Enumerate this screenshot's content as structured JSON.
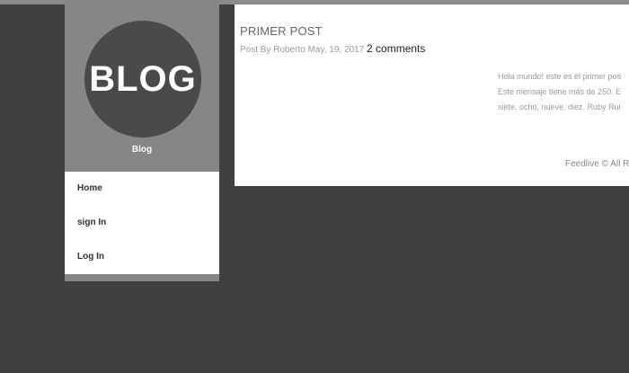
{
  "sidebar": {
    "logo_text": "BLOG",
    "blog_name": "Blog",
    "nav": [
      {
        "label": "Home"
      },
      {
        "label": "sign In"
      },
      {
        "label": "Log In"
      }
    ]
  },
  "post": {
    "title": "PRIMER POST",
    "meta": "Post By Roberto May, 19, 2017",
    "comments_label": "2 comments",
    "body_lines": [
      "Hola mundo! este es el primer pos",
      "Este mensaje tiene más de 250. E",
      "siete, ocho, nueve, diez. Ruby Rul"
    ]
  },
  "footer": {
    "text": "Feedlive © All Ri"
  },
  "colors": {
    "page_background": "#404040",
    "sidebar_background": "#868686",
    "logo_circle": "#4a4a4a",
    "content_background": "#ffffff"
  }
}
